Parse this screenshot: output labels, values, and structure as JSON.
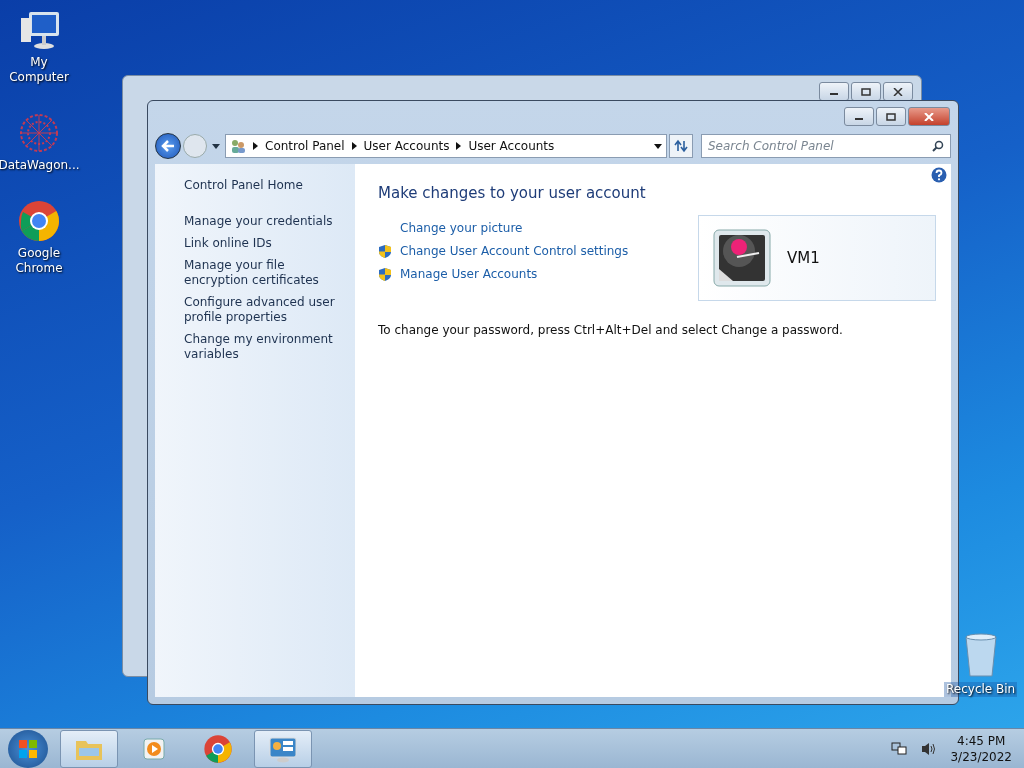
{
  "desktop_icons": [
    {
      "label": "My Computer",
      "kind": "computer"
    },
    {
      "label": "DataWagon...",
      "kind": "datawagon"
    },
    {
      "label": "Google Chrome",
      "kind": "chrome"
    }
  ],
  "recycle_bin": {
    "label": "Recycle Bin"
  },
  "window": {
    "breadcrumbs": [
      "Control Panel",
      "User Accounts",
      "User Accounts"
    ],
    "search": {
      "placeholder": "Search Control Panel"
    },
    "sidebar": {
      "home": "Control Panel Home",
      "items": [
        "Manage your credentials",
        "Link online IDs",
        "Manage your file encryption certificates",
        "Configure advanced user profile properties",
        "Change my environment variables"
      ]
    },
    "heading": "Make changes to your user account",
    "tasks": [
      {
        "label": "Change your picture",
        "kind": "plain"
      },
      {
        "label": "Change User Account Control settings",
        "kind": "shield"
      },
      {
        "label": "Manage User Accounts",
        "kind": "shield"
      }
    ],
    "account": {
      "name": "VM1"
    },
    "note": "To change your password, press Ctrl+Alt+Del and select Change a password."
  },
  "taskbar": {
    "items": [
      {
        "kind": "explorer",
        "open": true
      },
      {
        "kind": "media",
        "open": false
      },
      {
        "kind": "chrome",
        "open": false
      },
      {
        "kind": "control",
        "open": true
      }
    ],
    "time": "4:45 PM",
    "date": "3/23/2022"
  }
}
